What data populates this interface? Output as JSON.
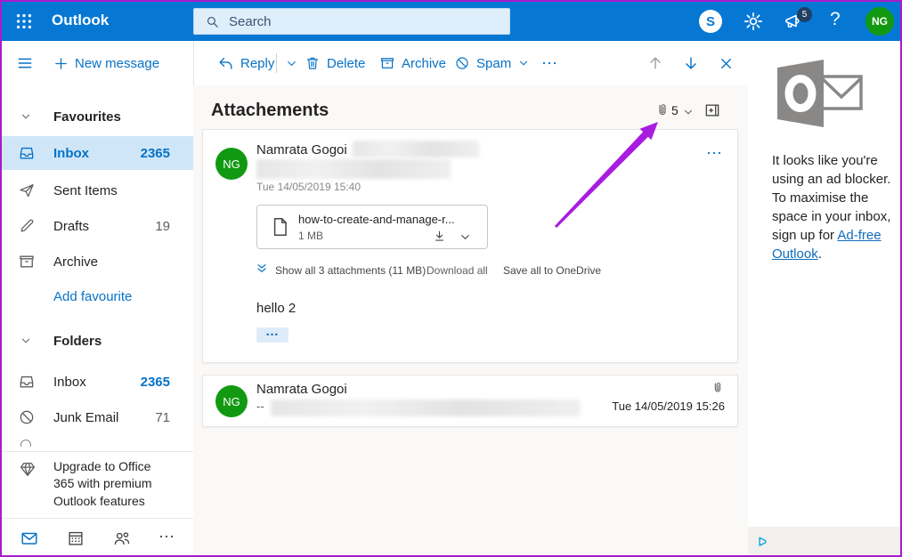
{
  "topbar": {
    "brand": "Outlook",
    "search_placeholder": "Search",
    "skype_letter": "S",
    "badge": "5",
    "avatar_initials": "NG"
  },
  "toolbar": {
    "new_message": "New message",
    "reply": "Reply",
    "delete": "Delete",
    "archive": "Archive",
    "spam": "Spam"
  },
  "sidebar": {
    "favourites_label": "Favourites",
    "fav_items": [
      {
        "label": "Inbox",
        "count": "2365"
      },
      {
        "label": "Sent Items",
        "count": ""
      },
      {
        "label": "Drafts",
        "count": "19"
      },
      {
        "label": "Archive",
        "count": ""
      }
    ],
    "add_favourite": "Add favourite",
    "folders_label": "Folders",
    "folder_items": [
      {
        "label": "Inbox",
        "count": "2365"
      },
      {
        "label": "Junk Email",
        "count": "71"
      }
    ],
    "upgrade_text": "Upgrade to Office 365 with premium Outlook features"
  },
  "main": {
    "subject": "Attachements",
    "attachment_count": "5",
    "messages": [
      {
        "sender": "Namrata Gogoi",
        "initials": "NG",
        "timestamp": "Tue 14/05/2019 15:40",
        "attachment_name": "how-to-create-and-manage-r...",
        "attachment_size": "1 MB",
        "show_all": "Show all 3 attachments (11 MB)",
        "download_all": "Download all",
        "save_onedrive": "Save all to OneDrive",
        "body": "hello 2"
      },
      {
        "sender": "Namrata Gogoi",
        "initials": "NG",
        "preview_prefix": "--",
        "timestamp": "Tue 14/05/2019 15:26"
      }
    ]
  },
  "ad_rail": {
    "text": "It looks like you're using an ad blocker. To maximise the space in your inbox, sign up for ",
    "link_label": "Ad-free Outlook",
    "suffix": "."
  },
  "icons": {
    "help": "?",
    "more": "⋯",
    "expander": "…"
  },
  "colors": {
    "topbar_blue": "#0678d4",
    "accent_blue": "#0672c6",
    "selected_row": "#cfe6f8",
    "avatar_green": "#129912",
    "link_blue": "#0f6cbd",
    "badge_navy": "#1f3f63",
    "arrow_purple": "#a81ce0",
    "content_bg": "#faf9f8"
  }
}
